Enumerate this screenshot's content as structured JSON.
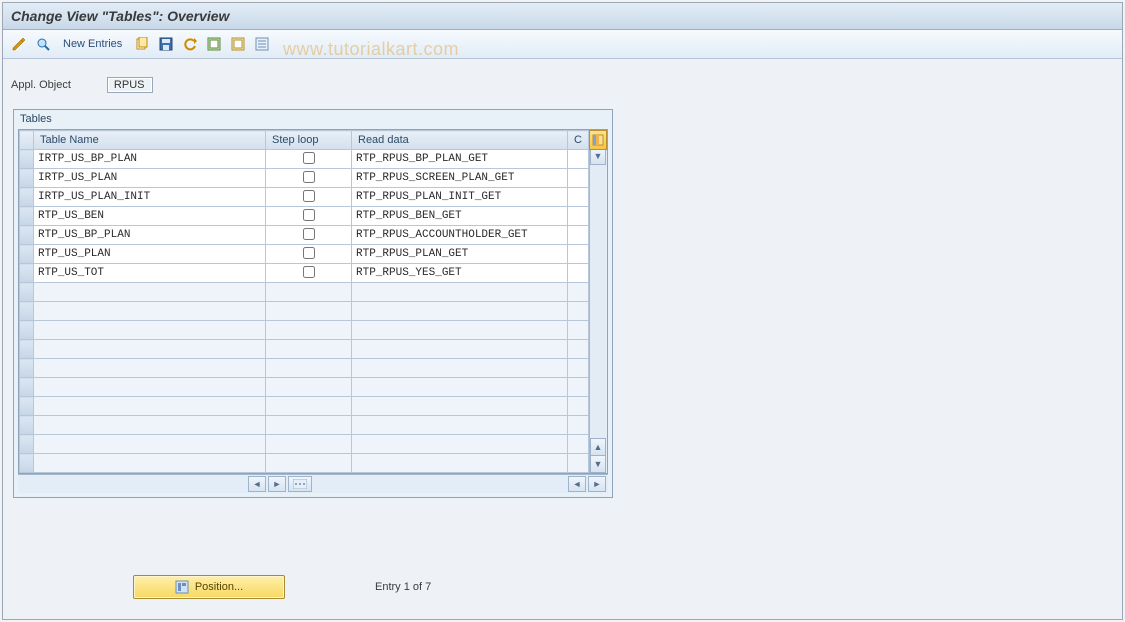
{
  "header": {
    "title": "Change View \"Tables\": Overview"
  },
  "toolbar": {
    "new_entries": "New Entries"
  },
  "watermark": "www.tutorialkart.com",
  "form": {
    "appl_object_label": "Appl. Object",
    "appl_object_value": "RPUS"
  },
  "table": {
    "caption": "Tables",
    "columns": {
      "name": "Table Name",
      "step": "Step loop",
      "read": "Read data",
      "c": "C"
    },
    "rows": [
      {
        "name": "IRTP_US_BP_PLAN",
        "step": false,
        "read": "RTP_RPUS_BP_PLAN_GET"
      },
      {
        "name": "IRTP_US_PLAN",
        "step": false,
        "read": "RTP_RPUS_SCREEN_PLAN_GET"
      },
      {
        "name": "IRTP_US_PLAN_INIT",
        "step": false,
        "read": "RTP_RPUS_PLAN_INIT_GET"
      },
      {
        "name": "RTP_US_BEN",
        "step": false,
        "read": "RTP_RPUS_BEN_GET"
      },
      {
        "name": "RTP_US_BP_PLAN",
        "step": false,
        "read": "RTP_RPUS_ACCOUNTHOLDER_GET"
      },
      {
        "name": "RTP_US_PLAN",
        "step": false,
        "read": "RTP_RPUS_PLAN_GET"
      },
      {
        "name": "RTP_US_TOT",
        "step": false,
        "read": "RTP_RPUS_YES_GET"
      }
    ],
    "empty_rows": 10
  },
  "footer": {
    "position_label": "Position...",
    "entry_text": "Entry 1 of 7"
  }
}
